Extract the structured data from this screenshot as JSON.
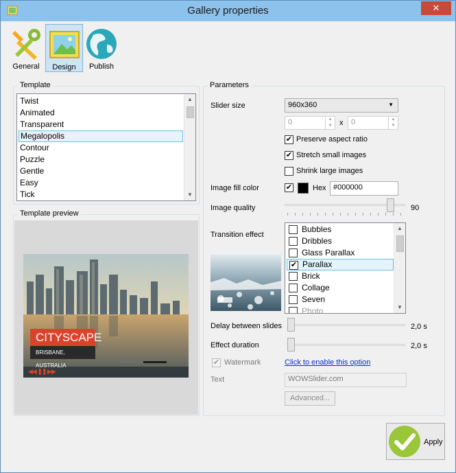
{
  "window": {
    "title": "Gallery properties",
    "close_glyph": "✕"
  },
  "toolbar": [
    {
      "label": "General",
      "icon": "wrench-screwdriver-icon"
    },
    {
      "label": "Design",
      "icon": "picture-icon",
      "active": true
    },
    {
      "label": "Publish",
      "icon": "globe-icon"
    }
  ],
  "template": {
    "legend": "Template",
    "items": [
      "Twist",
      "Animated",
      "Transparent",
      "Megalopolis",
      "Contour",
      "Puzzle",
      "Gentle",
      "Easy",
      "Tick"
    ],
    "selected": "Megalopolis"
  },
  "preview": {
    "legend": "Template preview",
    "caption_title": "CITYSCAPE",
    "caption_subtitle": "BRISBANE, AUSTRALIA",
    "controls": "◀◀ ❚❚ ▶▶"
  },
  "parameters": {
    "legend": "Parameters",
    "slider_size_label": "Slider size",
    "slider_size_value": "960x360",
    "width_value": "0",
    "height_value": "0",
    "x_sep": "x",
    "preserve_aspect": {
      "label": "Preserve aspect ratio",
      "checked": true
    },
    "stretch_small": {
      "label": "Stretch small images",
      "checked": true
    },
    "shrink_large": {
      "label": "Shrink large images",
      "checked": false
    },
    "image_fill_label": "Image fill color",
    "fill_checked": true,
    "fill_color": "#000000",
    "hex_label": "Hex",
    "hex_value": "#000000",
    "image_quality_label": "Image quality",
    "image_quality_value": "90",
    "image_quality_level": 0.9,
    "transition_label": "Transition effect",
    "transitions": [
      {
        "name": "Bubbles",
        "checked": false
      },
      {
        "name": "Dribbles",
        "checked": false
      },
      {
        "name": "Glass Parallax",
        "checked": false
      },
      {
        "name": "Parallax",
        "checked": true
      },
      {
        "name": "Brick",
        "checked": false
      },
      {
        "name": "Collage",
        "checked": false
      },
      {
        "name": "Seven",
        "checked": false
      },
      {
        "name": "Photo",
        "checked": false
      }
    ],
    "delay_label": "Delay between slides",
    "delay_value": "2,0 s",
    "duration_label": "Effect duration",
    "duration_value": "2,0 s",
    "watermark_label": "Watermark",
    "watermark_checked": true,
    "watermark_link": "Click to enable this option",
    "text_label": "Text",
    "text_value": "WOWSlider.com",
    "advanced_label": "Advanced..."
  },
  "apply_label": "Apply",
  "check_glyph": "✔",
  "colors": {
    "titlebar": "#8cc2ec",
    "accent": "#9ac63a",
    "close": "#c7493a",
    "caption": "#d9432b"
  }
}
